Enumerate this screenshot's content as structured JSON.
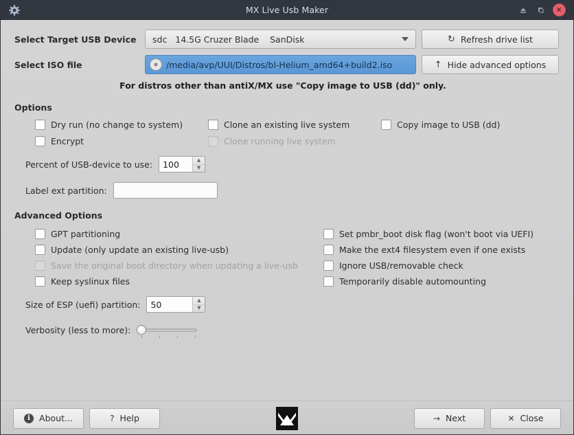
{
  "window": {
    "title": "MX Live Usb Maker",
    "app_icon": "gear-icon",
    "controls": {
      "shade": "▲",
      "restore": "◳",
      "close": "✕"
    }
  },
  "form": {
    "target_device": {
      "label": "Select Target USB Device",
      "value": "sdc   14.5G Cruzer Blade    SanDisk",
      "refresh_button": "Refresh drive list",
      "refresh_icon": "↻"
    },
    "iso_file": {
      "label": "Select ISO file",
      "value": "/media/avp/UUI/Distros/bl-Helium_amd64+build2.iso",
      "advanced_button": "Hide advanced options",
      "advanced_icon": "↑"
    },
    "notice": "For distros other than antiX/MX use \"Copy image to USB (dd)\" only."
  },
  "options": {
    "heading": "Options",
    "checkboxes": [
      {
        "label": "Dry run (no change to system)",
        "checked": false,
        "disabled": false
      },
      {
        "label": "Clone an existing live system",
        "checked": false,
        "disabled": false
      },
      {
        "label": "Copy image to USB (dd)",
        "checked": false,
        "disabled": false
      },
      {
        "label": "Encrypt",
        "checked": false,
        "disabled": false
      },
      {
        "label": "Clone running live system",
        "checked": false,
        "disabled": true
      }
    ],
    "percent_field": {
      "label": "Percent of USB-device to use:",
      "value": "100"
    },
    "label_field": {
      "label": "Label ext partition:",
      "value": "",
      "placeholder": ""
    }
  },
  "advanced": {
    "heading": "Advanced Options",
    "checkboxes_left": [
      {
        "label": "GPT partitioning",
        "checked": false,
        "disabled": false
      },
      {
        "label": "Update (only update an existing live-usb)",
        "checked": false,
        "disabled": false
      },
      {
        "label": "Save the original boot directory when updating a live-usb",
        "checked": false,
        "disabled": true
      },
      {
        "label": "Keep syslinux files",
        "checked": false,
        "disabled": false
      }
    ],
    "checkboxes_right": [
      {
        "label": "Set pmbr_boot disk flag (won't boot via UEFI)",
        "checked": false,
        "disabled": false
      },
      {
        "label": "Make the ext4 filesystem even if one exists",
        "checked": false,
        "disabled": false
      },
      {
        "label": "Ignore USB/removable check",
        "checked": false,
        "disabled": false
      },
      {
        "label": "Temporarily disable automounting",
        "checked": false,
        "disabled": false
      }
    ],
    "esp_field": {
      "label": "Size of ESP (uefi) partition:",
      "value": "50"
    },
    "verbosity": {
      "label": "Verbosity (less to more):",
      "value": 0,
      "min": 0,
      "max": 3
    }
  },
  "footer": {
    "about": {
      "label": "About...",
      "icon": "i"
    },
    "help": {
      "label": "Help",
      "icon": "?"
    },
    "logo": "mx-linux-logo",
    "next": {
      "label": "Next",
      "icon": "→"
    },
    "close": {
      "label": "Close",
      "icon": "✕"
    }
  },
  "colors": {
    "titlebar": "#32363f",
    "window_bg": "#d2d2d2",
    "accent_blue": "#5b97d6",
    "close_red": "#e4606d"
  }
}
